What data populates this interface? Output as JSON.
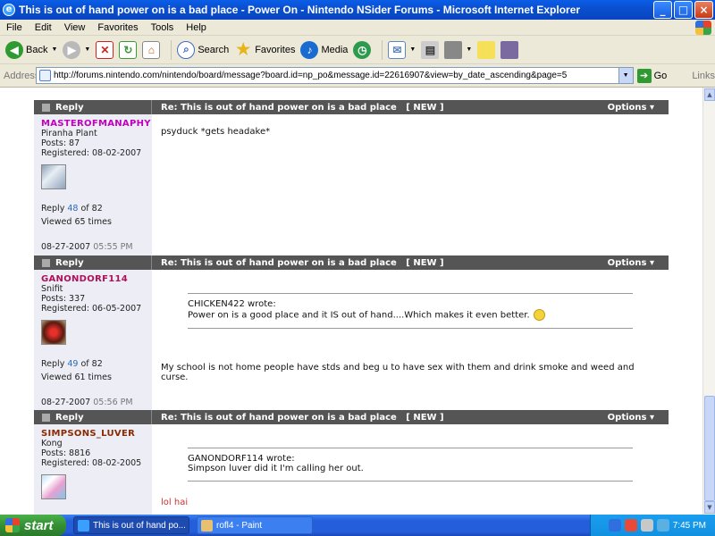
{
  "window": {
    "title": "This is out of hand power on is a bad place - Power On - Nintendo NSider Forums - Microsoft Internet Explorer",
    "minimize": "_",
    "maximize": "□",
    "close": "×"
  },
  "menu": [
    "File",
    "Edit",
    "View",
    "Favorites",
    "Tools",
    "Help"
  ],
  "toolbar": {
    "back": "Back",
    "search": "Search",
    "favorites": "Favorites",
    "media": "Media"
  },
  "address": {
    "label": "Address",
    "url": "http://forums.nintendo.com/nintendo/board/message?board.id=np_po&message.id=22616907&view=by_date_ascending&page=5",
    "go": "Go",
    "links": "Links"
  },
  "posts": [
    {
      "reply_label": "Reply",
      "subject": "Re: This is out of hand power on is a bad place",
      "new_tag": "[ NEW ]",
      "options": "Options",
      "username": "MASTEROFMANAPHY",
      "rank": "Piranha Plant",
      "posts": "Posts: 87",
      "registered": "Registered: 08-02-2007",
      "reply_prefix": "Reply",
      "reply_num": "48",
      "reply_suffix": "of 82",
      "viewed": "Viewed 65 times",
      "date": "08-27-2007",
      "time": "05:55 PM",
      "body": "psyduck *gets headake*"
    },
    {
      "reply_label": "Reply",
      "subject": "Re: This is out of hand power on is a bad place",
      "new_tag": "[ NEW ]",
      "options": "Options",
      "username": "GANONDORF114",
      "rank": "Snifit",
      "posts": "Posts: 337",
      "registered": "Registered: 06-05-2007",
      "reply_prefix": "Reply",
      "reply_num": "49",
      "reply_suffix": "of 82",
      "viewed": "Viewed 61 times",
      "date": "08-27-2007",
      "time": "05:56 PM",
      "quote_author": "CHICKEN422 wrote:",
      "quote_text": "Power on is a good place and it IS out of hand....Which makes it even better.",
      "body": "My school is not home people have stds and beg u to have sex with them and drink smoke and weed and curse."
    },
    {
      "reply_label": "Reply",
      "subject": "Re: This is out of hand power on is a bad place",
      "new_tag": "[ NEW ]",
      "options": "Options",
      "username": "SIMPSONS_LUVER",
      "rank": "Kong",
      "posts": "Posts: 8816",
      "registered": "Registered: 08-02-2005",
      "quote_author": "GANONDORF114 wrote:",
      "quote_text": "Simpson luver did it I'm calling her out.",
      "body": "lol hai"
    }
  ],
  "taskbar": {
    "start": "start",
    "tasks": [
      "This is out of hand po...",
      "rofl4 - Paint"
    ],
    "clock": "7:45 PM"
  }
}
